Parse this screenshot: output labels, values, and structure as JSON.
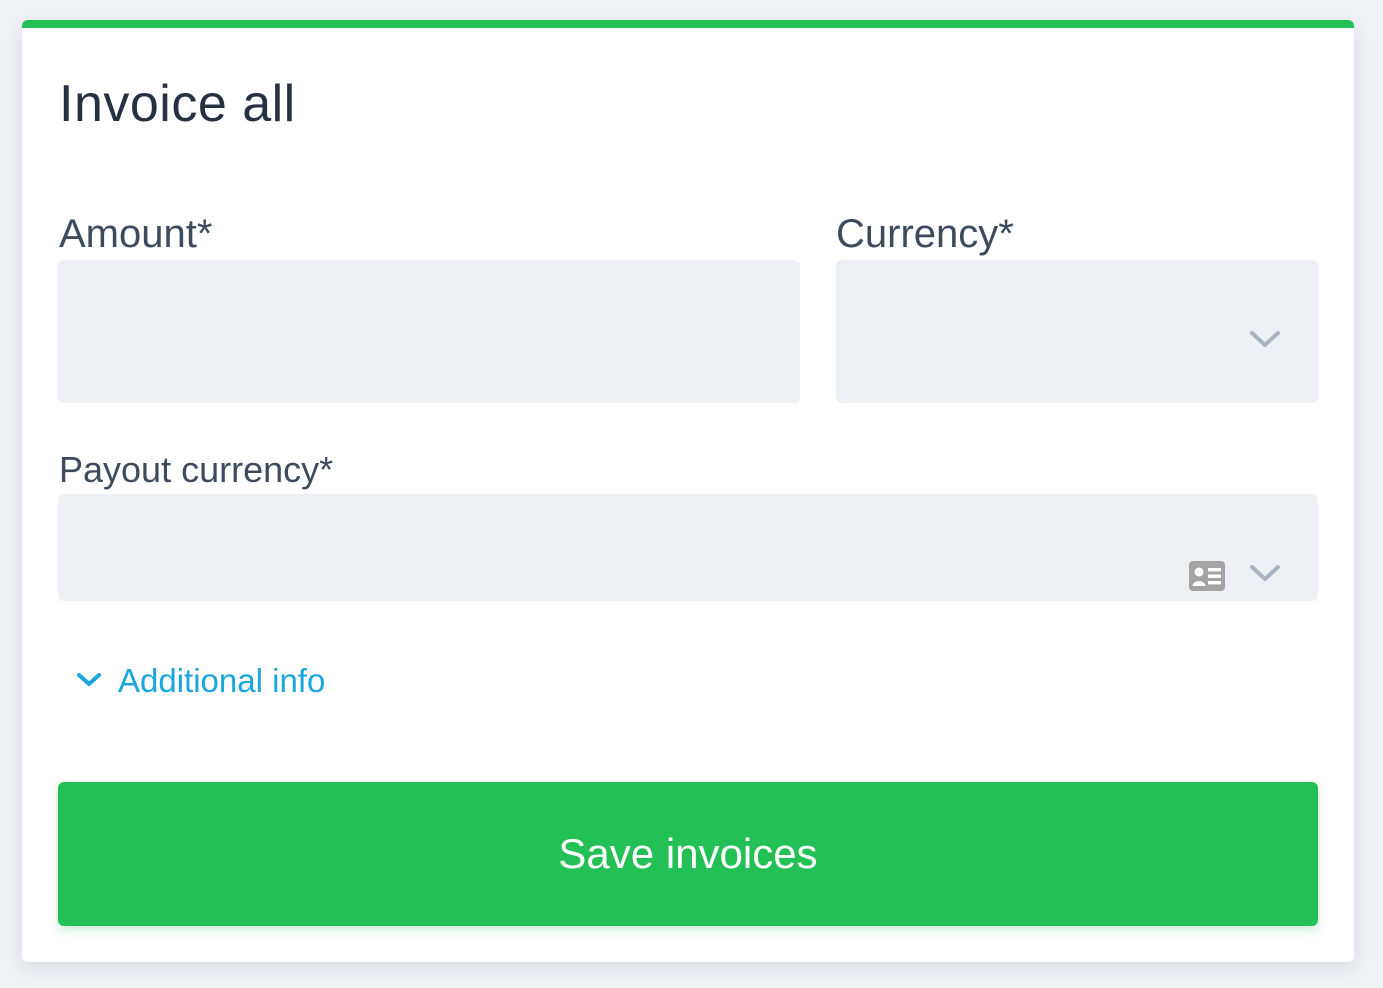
{
  "form": {
    "title": "Invoice all",
    "amount": {
      "label": "Amount*",
      "value": "",
      "placeholder": ""
    },
    "currency": {
      "label": "Currency*",
      "selected": ""
    },
    "payout_currency": {
      "label": "Payout currency*",
      "selected": ""
    },
    "additional_info_label": "Additional info",
    "save_label": "Save invoices"
  },
  "icons": {
    "currency_dropdown": "chevron-down-icon",
    "payout_dropdown": "chevron-down-icon",
    "payout_contact": "contact-card-icon",
    "additional_toggle": "chevron-down-icon"
  },
  "colors": {
    "accent_green": "#22c055",
    "link_blue": "#1aa6de",
    "field_background": "#edf1f5",
    "icon_grey": "#a9b4c2"
  }
}
